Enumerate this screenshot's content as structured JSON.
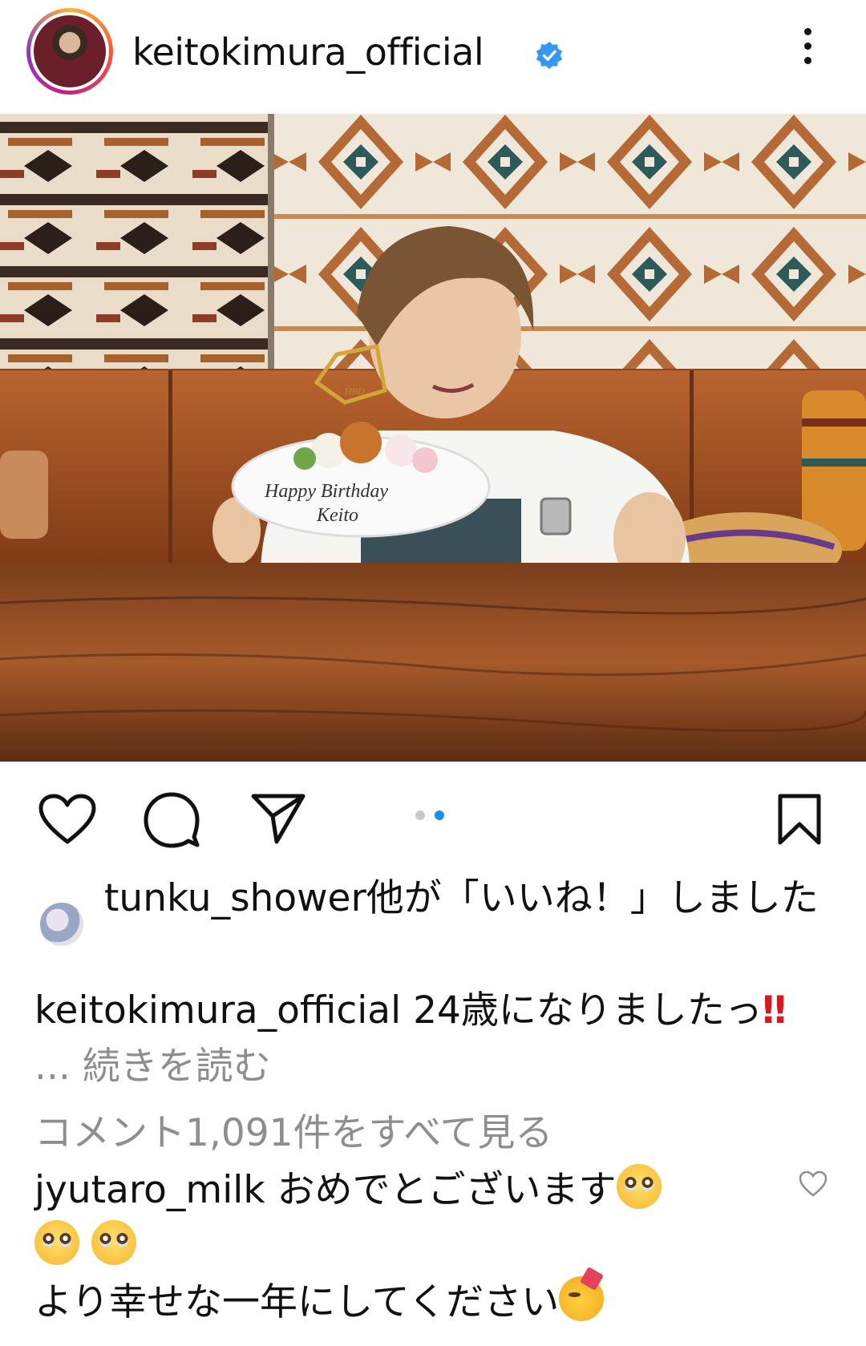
{
  "post": {
    "username": "keitokimura_official",
    "verified": true
  },
  "carousel": {
    "current": 2,
    "total": 2,
    "active_color": "#1a8ef0",
    "inactive_color": "#c8c8c8"
  },
  "plate_text": {
    "line1": "Happy Birthday",
    "line2": "Keito"
  },
  "likes": {
    "text": "tunku_shower他が「いいね！」しました"
  },
  "caption": {
    "username": "keitokimura_official",
    "text": "24歳になりましたっ",
    "emphasis": "‼",
    "ellipsis": "...",
    "more_label": "続きを読む"
  },
  "comments": {
    "view_all_label": "コメント1,091件をすべて見る",
    "top": {
      "username": "jyutaro_milk",
      "text_line1": "おめでとございます",
      "text_line2": "より幸せな一年にしてください",
      "emoji_1": "pleading-face-icon",
      "emoji_2": "partying-face-icon"
    }
  },
  "colors": {
    "verified_blue": "#3897f0",
    "text": "#111111",
    "muted": "#8e8e8e",
    "accent_red": "#d8191f"
  }
}
